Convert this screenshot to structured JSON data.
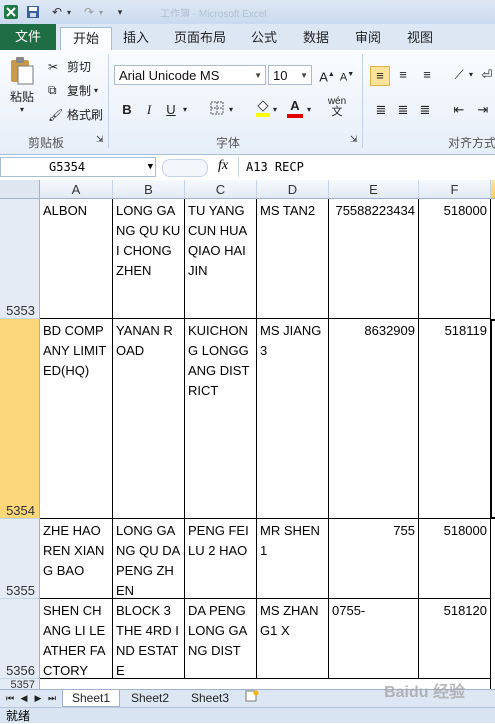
{
  "title_bar": {
    "title": "工作簿 - Microsoft Excel"
  },
  "ribbon": {
    "tabs": [
      "文件",
      "开始",
      "插入",
      "页面布局",
      "公式",
      "数据",
      "审阅",
      "视图"
    ],
    "active_tab": "开始",
    "clipboard": {
      "paste": "粘贴",
      "cut": "剪切",
      "copy": "复制",
      "format_painter": "格式刷",
      "group": "剪贴板"
    },
    "font": {
      "name": "Arial Unicode MS",
      "size": "10",
      "bold": "B",
      "italic": "I",
      "underline": "U",
      "font_color_glyph": "A",
      "phonetic": "wén",
      "group": "字体"
    },
    "alignment": {
      "group": "对齐方式"
    }
  },
  "formula_bar": {
    "name_box": "G5354",
    "fx": "fx",
    "content": "A13 RECP"
  },
  "columns": [
    "A",
    "B",
    "C",
    "D",
    "E",
    "F"
  ],
  "rows": [
    {
      "num": "5353",
      "cells": [
        "ALBON",
        "LONG GANG QU KUI CHONG ZHEN",
        "TU YANG CUN HUA QIAO HAI JIN",
        "MS TAN2",
        "75588223434",
        "518000"
      ]
    },
    {
      "num": "5354",
      "cells": [
        "BD COMPANY LIMITED(HQ)",
        "YANAN ROAD",
        "KUICHONG LONGGANG DISTRICT",
        "MS JIANG3",
        "8632909",
        "518119"
      ]
    },
    {
      "num": "5355",
      "cells": [
        "ZHE HAO REN XIANG BAO",
        "LONG GANG QU DA PENG ZHEN",
        "PENG FEI LU 2 HAO",
        "MR SHEN1",
        "755",
        "518000"
      ]
    },
    {
      "num": "5356",
      "cells": [
        "SHEN CHANG LI LEATHER FACTORY",
        "BLOCK 3 THE 4RD IND ESTATE",
        "DA PENG LONG GANG DIST",
        "MS ZHANG1 X",
        "0755-",
        "518120"
      ]
    },
    {
      "num": "5357",
      "cells": [
        "",
        "",
        "",
        "",
        "",
        ""
      ]
    }
  ],
  "sheets": [
    "Sheet1",
    "Sheet2",
    "Sheet3"
  ],
  "active_sheet": "Sheet1",
  "status": "就绪",
  "watermark": "Baidu 经验",
  "colors": {
    "excel_green": "#1f6e43",
    "selection": "#fbd77a"
  }
}
